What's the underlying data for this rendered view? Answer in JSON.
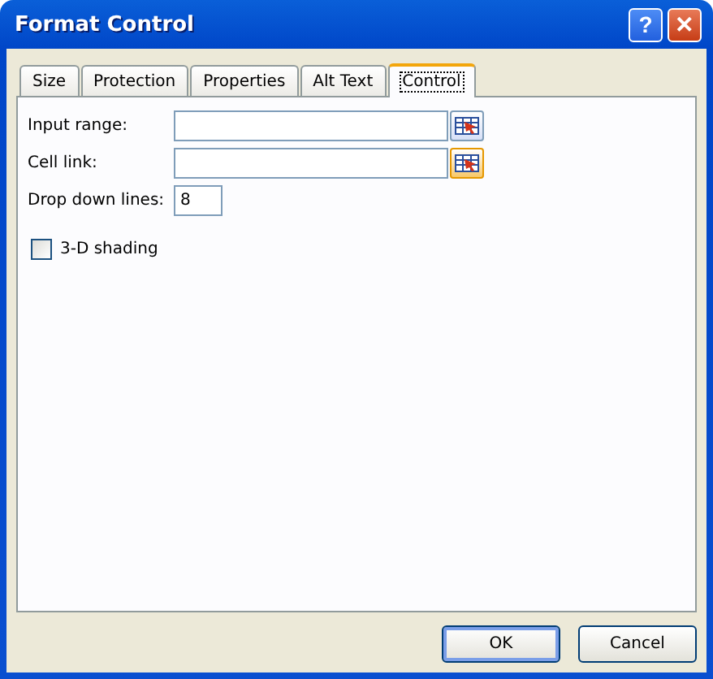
{
  "window": {
    "title": "Format Control",
    "help": "?",
    "close": "✕"
  },
  "tabs": [
    {
      "label": "Size",
      "selected": false
    },
    {
      "label": "Protection",
      "selected": false
    },
    {
      "label": "Properties",
      "selected": false
    },
    {
      "label": "Alt Text",
      "selected": false
    },
    {
      "label": "Control",
      "selected": true
    }
  ],
  "fields": [
    {
      "kind": "ref",
      "label": "Input range:",
      "highlighted": false
    },
    {
      "kind": "ref",
      "label": "Cell link:",
      "highlighted": true
    },
    {
      "kind": "number",
      "label": "Drop down lines:",
      "value": "8"
    }
  ],
  "shading": {
    "label": "3-D shading",
    "checked": false
  },
  "buttons": [
    {
      "label": "OK",
      "default": true
    },
    {
      "label": "Cancel",
      "default": false
    }
  ]
}
